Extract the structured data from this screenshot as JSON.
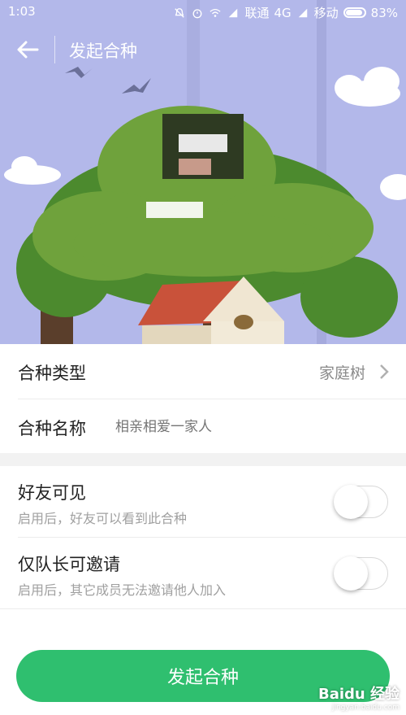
{
  "statusbar": {
    "time": "1:03",
    "carrier1": "联通",
    "network": "4G",
    "carrier2": "移动",
    "battery": "83%"
  },
  "appbar": {
    "title": "发起合种"
  },
  "form": {
    "type_label": "合种类型",
    "type_value": "家庭树",
    "name_label": "合种名称",
    "name_placeholder": "相亲相爱一家人"
  },
  "settings": [
    {
      "label": "好友可见",
      "desc": "启用后，好友可以看到此合种",
      "enabled": false
    },
    {
      "label": "仅队长可邀请",
      "desc": "启用后，其它成员无法邀请他人加入",
      "enabled": false
    }
  ],
  "submit_label": "发起合种",
  "watermark": {
    "brand": "Baidu 经验",
    "url": "jingyan.baidu.com"
  },
  "colors": {
    "accent": "#2fbf6f",
    "hero_bg": "#aab3e6",
    "tree": "#5f9a3a"
  }
}
